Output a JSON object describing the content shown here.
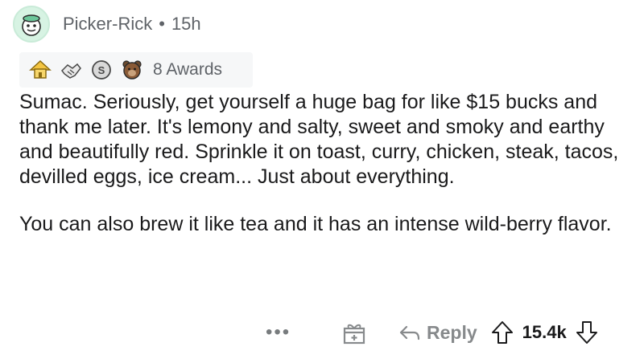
{
  "header": {
    "username": "Picker-Rick",
    "separator": "•",
    "time": "15h"
  },
  "awards": {
    "icons": [
      "house-award-icon",
      "handshake-award-icon",
      "silver-coin-award-icon",
      "bear-award-icon"
    ],
    "count_label": "8 Awards"
  },
  "comment": {
    "paragraphs": [
      "Sumac. Seriously, get yourself a huge bag for like $15 bucks and thank me later. It's lemony and salty, sweet and smoky and earthy and beautifully red. Sprinkle it on toast, curry, chicken, steak, tacos, devilled eggs, ice cream... Just about everything.",
      "You can also brew it like tea and it has an intense wild-berry flavor."
    ]
  },
  "footer": {
    "more_label": "•••",
    "reply_label": "Reply",
    "score": "15.4k"
  },
  "colors": {
    "text": "#1a1a1b",
    "meta": "#5f6368",
    "award_bg": "#f6f7f8",
    "action": "#878a8c"
  }
}
